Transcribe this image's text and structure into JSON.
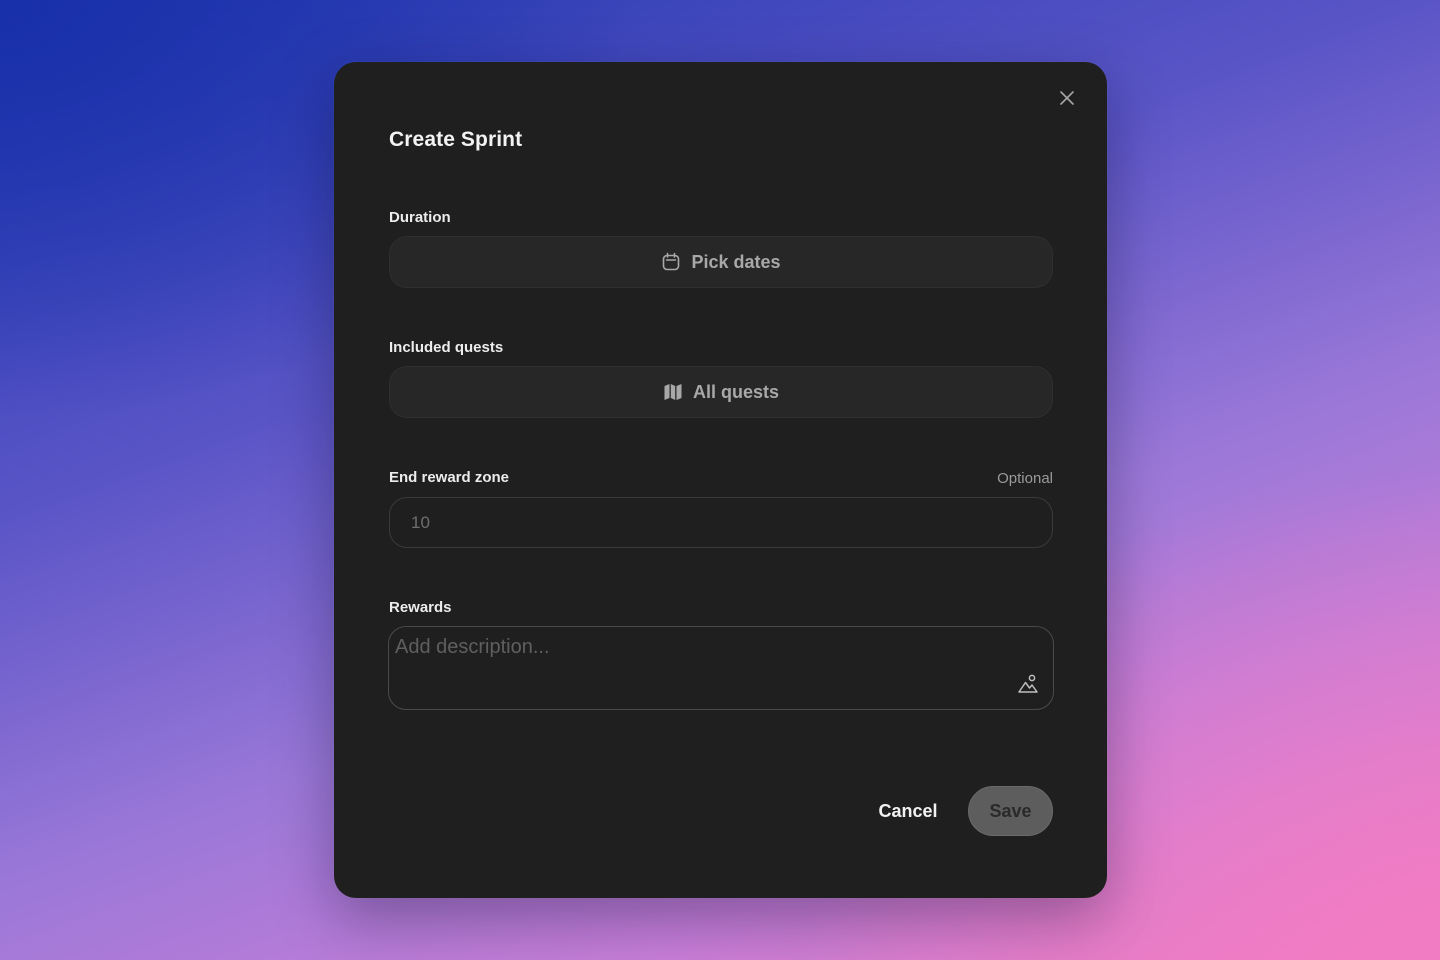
{
  "modal": {
    "title": "Create Sprint",
    "close_icon": "close-icon"
  },
  "duration": {
    "label": "Duration",
    "button_label": "Pick dates",
    "icon": "calendar-icon"
  },
  "included_quests": {
    "label": "Included quests",
    "button_label": "All quests",
    "icon": "map-icon"
  },
  "end_reward_zone": {
    "label": "End reward zone",
    "optional_label": "Optional",
    "placeholder": "10",
    "value": ""
  },
  "rewards": {
    "label": "Rewards",
    "placeholder": "Add description...",
    "value": "",
    "image_icon": "image-upload-icon"
  },
  "actions": {
    "cancel_label": "Cancel",
    "save_label": "Save"
  },
  "colors": {
    "modal_bg": "#1f1f1f",
    "field_bg": "#272727",
    "save_bg": "#5d5d5d",
    "text_primary": "#ececec",
    "text_muted": "#a8a8a8"
  }
}
